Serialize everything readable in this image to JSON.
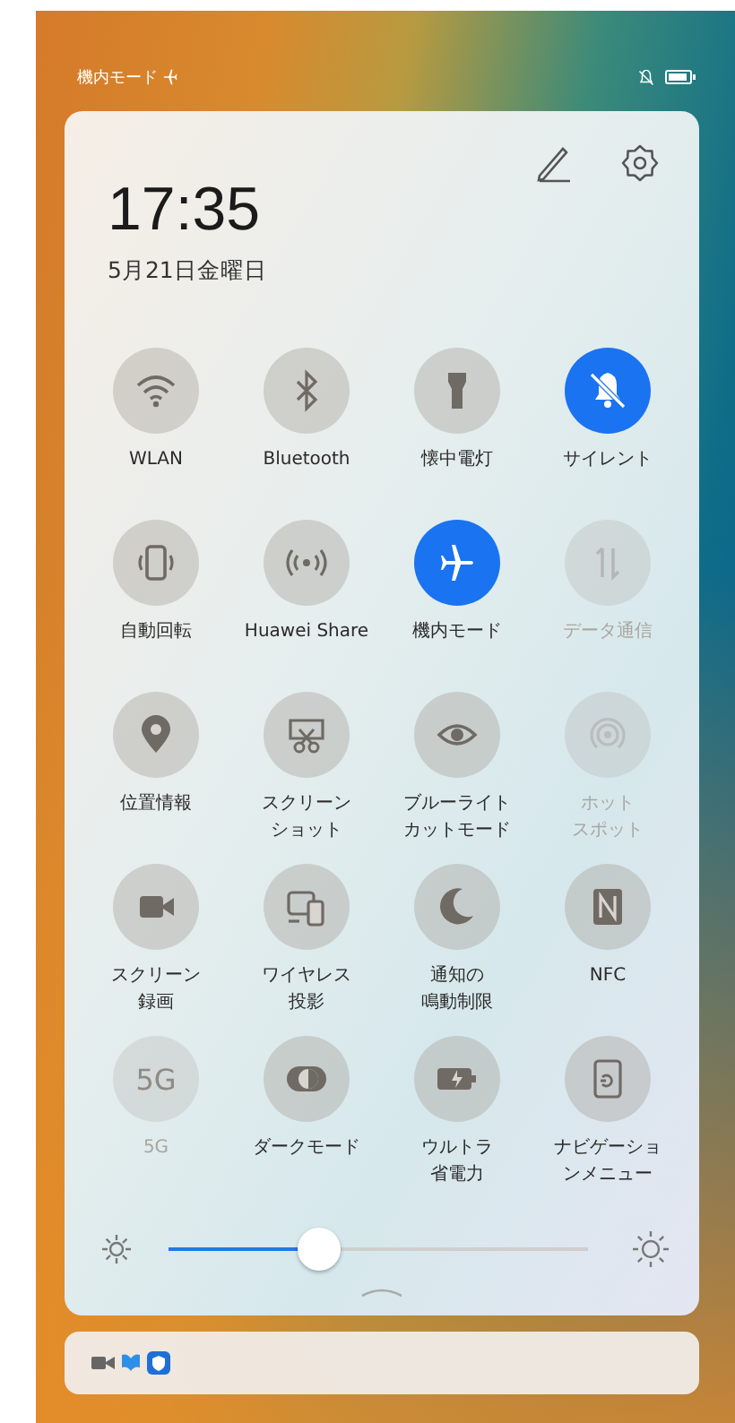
{
  "status_bar": {
    "mode_label": "機内モード"
  },
  "header": {
    "time": "17:35",
    "date": "5月21日金曜日"
  },
  "tiles": [
    {
      "label": "WLAN",
      "on": false,
      "disabled": false
    },
    {
      "label": "Bluetooth",
      "on": false,
      "disabled": false
    },
    {
      "label": "懐中電灯",
      "on": false,
      "disabled": false
    },
    {
      "label": "サイレント",
      "on": true,
      "disabled": false
    },
    {
      "label": "自動回転",
      "on": false,
      "disabled": false
    },
    {
      "label": "Huawei Share",
      "on": false,
      "disabled": false
    },
    {
      "label": "機内モード",
      "on": true,
      "disabled": false
    },
    {
      "label": "データ通信",
      "on": false,
      "disabled": true
    },
    {
      "label": "位置情報",
      "on": false,
      "disabled": false
    },
    {
      "label": [
        "スクリーン",
        "ショット"
      ],
      "on": false,
      "disabled": false
    },
    {
      "label": [
        "ブルーライト",
        "カットモード"
      ],
      "on": false,
      "disabled": false
    },
    {
      "label": [
        "ホット",
        "スポット"
      ],
      "on": false,
      "disabled": true
    },
    {
      "label": [
        "スクリーン",
        "録画"
      ],
      "on": false,
      "disabled": false
    },
    {
      "label": [
        "ワイヤレス",
        "投影"
      ],
      "on": false,
      "disabled": false
    },
    {
      "label": [
        "通知の",
        "鳴動制限"
      ],
      "on": false,
      "disabled": false
    },
    {
      "label": "NFC",
      "on": false,
      "disabled": false
    },
    {
      "label": "5G",
      "on": false,
      "disabled": true,
      "icon_text": "5G"
    },
    {
      "label": "ダークモード",
      "on": false,
      "disabled": false
    },
    {
      "label": [
        "ウルトラ",
        "省電力"
      ],
      "on": false,
      "disabled": false
    },
    {
      "label": [
        "ナビゲーショ",
        "ンメニュー"
      ],
      "on": false,
      "disabled": false
    }
  ],
  "brightness": {
    "level": 0.36
  }
}
